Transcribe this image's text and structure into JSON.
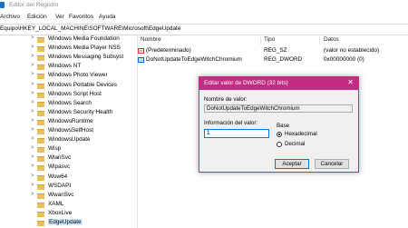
{
  "window": {
    "title": "Editor del Registro"
  },
  "menu": [
    "Archivo",
    "Edición",
    "Ver",
    "Favoritos",
    "Ayuda"
  ],
  "address": "Equipo\\HKEY_LOCAL_MACHINE\\SOFTWARE\\Microsoft\\EdgeUpdate",
  "tree": {
    "items": [
      {
        "label": "Windows Media Foundation",
        "expandable": true
      },
      {
        "label": "Windows Media Player NSS",
        "expandable": true
      },
      {
        "label": "Windows Messaging Subsyst",
        "expandable": true
      },
      {
        "label": "Windows NT",
        "expandable": true
      },
      {
        "label": "Windows Photo Viewer",
        "expandable": true
      },
      {
        "label": "Windows Portable Devices",
        "expandable": true
      },
      {
        "label": "Windows Script Host",
        "expandable": true
      },
      {
        "label": "Windows Search",
        "expandable": true
      },
      {
        "label": "Windows Security Health",
        "expandable": true
      },
      {
        "label": "WindowsRuntime",
        "expandable": true
      },
      {
        "label": "WindowsSelfHost",
        "expandable": true
      },
      {
        "label": "WindowsUpdate",
        "expandable": true
      },
      {
        "label": "Wisp",
        "expandable": true
      },
      {
        "label": "WlanSvc",
        "expandable": true
      },
      {
        "label": "Wlpasvc",
        "expandable": true
      },
      {
        "label": "Wow64",
        "expandable": true
      },
      {
        "label": "WSDAPI",
        "expandable": true
      },
      {
        "label": "WwanSvc",
        "expandable": true
      },
      {
        "label": "XAML",
        "expandable": false
      },
      {
        "label": "XboxLive",
        "expandable": false
      },
      {
        "label": "EdgeUpdate",
        "expandable": false,
        "selected": true
      }
    ]
  },
  "list": {
    "headers": {
      "name": "Nombre",
      "type": "Tipo",
      "data": "Datos"
    },
    "rows": [
      {
        "icon": "ab",
        "name": "(Predeterminado)",
        "type": "REG_SZ",
        "data": "(valor no establecido)"
      },
      {
        "icon": "01",
        "name": "DoNotUpdateToEdgeWitchChromium",
        "type": "REG_DWORD",
        "data": "0x00000000 (0)"
      }
    ]
  },
  "dialog": {
    "title": "Editar valor de DWORD (32 bits)",
    "close_glyph": "✕",
    "name_label": "Nombre de valor:",
    "name_value": "DoNotUpdateToEdgeWitchChromium",
    "data_label": "Información del valor:",
    "data_value": "1",
    "base_label": "Base",
    "base_options": [
      {
        "label": "Hexadecimal",
        "checked": true
      },
      {
        "label": "Decimal",
        "checked": false
      }
    ],
    "ok_label": "Aceptar",
    "cancel_label": "Cancelar"
  },
  "colors": {
    "accent": "#c42b82",
    "selection": "#cce8ff"
  }
}
